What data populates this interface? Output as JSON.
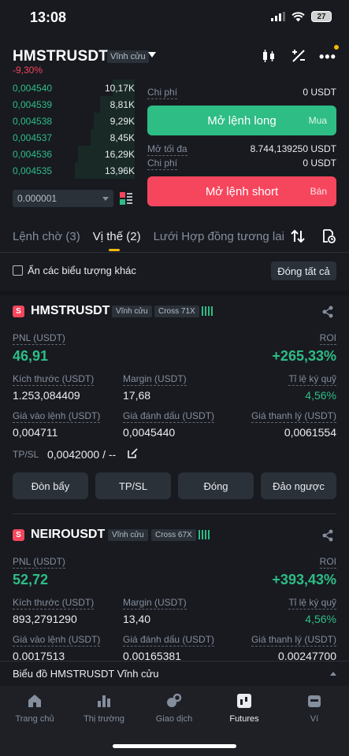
{
  "status": {
    "time": "13:08",
    "battery": "27"
  },
  "header": {
    "symbol": "HMSTRUSDT",
    "contract_type": "Vĩnh cửu",
    "change": "-9,30%"
  },
  "orderbook": {
    "rows": [
      {
        "price": "0,004540",
        "qty": "10,17K",
        "depth": 0.35
      },
      {
        "price": "0,004539",
        "qty": "8,81K",
        "depth": 0.55
      },
      {
        "price": "0,004538",
        "qty": "9,29K",
        "depth": 0.65
      },
      {
        "price": "0,004537",
        "qty": "8,45K",
        "depth": 0.7
      },
      {
        "price": "0,004536",
        "qty": "16,29K",
        "depth": 0.9
      },
      {
        "price": "0,004535",
        "qty": "13,96K",
        "depth": 0.95
      }
    ],
    "tick_size": "0.000001"
  },
  "order_panel": {
    "cost_label": "Chi phí",
    "cost_value_top": "0 USDT",
    "long_label": "Mở lệnh long",
    "long_sub": "Mua",
    "max_label": "Mở tối đa",
    "max_value": "8.744,139250 USDT",
    "cost_value_bottom": "0 USDT",
    "short_label": "Mở lệnh short",
    "short_sub": "Bán"
  },
  "tabs": [
    "Lệnh chờ (3)",
    "Vị thế (2)",
    "Lưới Hợp đồng tương lai"
  ],
  "hide_symbols_label": "Ẩn các biểu tượng khác",
  "close_all_label": "Đóng tất cả",
  "positions": [
    {
      "side": "S",
      "symbol": "HMSTRUSDT",
      "type": "Vĩnh cửu",
      "margin_mode": "Cross 71X",
      "pnl_label": "PNL (USDT)",
      "pnl": "46,91",
      "roi_label": "ROI",
      "roi": "+265,33%",
      "size_label": "Kích thước (USDT)",
      "size": "1.253,084409",
      "margin_label": "Margin (USDT)",
      "margin": "17,68",
      "ratio_label": "Tỉ lệ ký quỹ",
      "ratio": "4,56%",
      "entry_label": "Giá vào lệnh (USDT)",
      "entry": "0,004711",
      "mark_label": "Giá đánh dấu (USDT)",
      "mark": "0,0045440",
      "liq_label": "Giá thanh lý (USDT)",
      "liq": "0,0061554",
      "tpsl_label": "TP/SL",
      "tpsl": "0,0042000 / --"
    },
    {
      "side": "S",
      "symbol": "NEIROUSDT",
      "type": "Vĩnh cửu",
      "margin_mode": "Cross 67X",
      "pnl_label": "PNL (USDT)",
      "pnl": "52,72",
      "roi_label": "ROI",
      "roi": "+393,43%",
      "size_label": "Kích thước (USDT)",
      "size": "893,2791290",
      "margin_label": "Margin (USDT)",
      "margin": "13,40",
      "ratio_label": "Tỉ lệ ký quỹ",
      "ratio": "4,56%",
      "entry_label": "Giá vào lệnh (USDT)",
      "entry": "0.0017513",
      "mark_label": "Giá đánh dấu (USDT)",
      "mark": "0.00165381",
      "liq_label": "Giá thanh lý (USDT)",
      "liq": "0.00247700"
    }
  ],
  "actions": {
    "leverage": "Đòn bẩy",
    "tpsl": "TP/SL",
    "close": "Đóng",
    "reverse": "Đảo ngược"
  },
  "chart_bar_label": "Biểu đồ HMSTRUSDT Vĩnh cửu",
  "nav": [
    "Trang chủ",
    "Thị trường",
    "Giao dịch",
    "Futures",
    "Ví"
  ],
  "colors": {
    "green": "#2ebd85",
    "red": "#f6465d",
    "background": "#181a20"
  }
}
